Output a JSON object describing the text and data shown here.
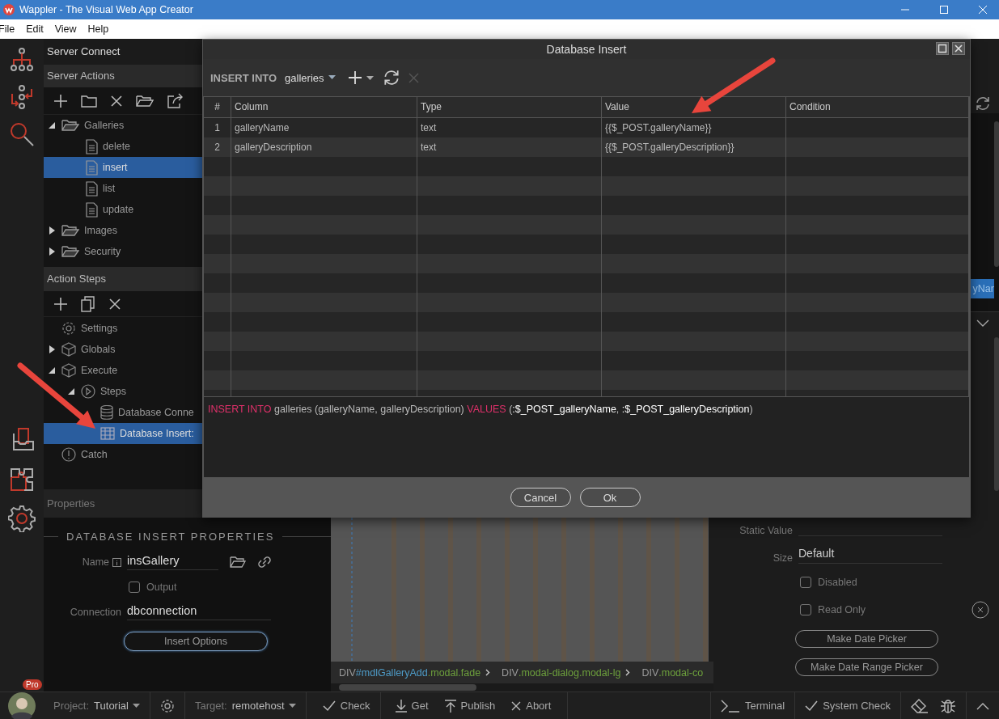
{
  "window": {
    "title": "Wappler - The Visual Web App Creator"
  },
  "menu": [
    "File",
    "Edit",
    "View",
    "Help"
  ],
  "server_connect": {
    "title": "Server Connect",
    "section": "Server Actions",
    "tree": [
      {
        "label": "Galleries",
        "kind": "folder",
        "expanded": true,
        "selected": false,
        "children": [
          {
            "label": "delete",
            "kind": "file",
            "selected": false
          },
          {
            "label": "insert",
            "kind": "file",
            "selected": true
          },
          {
            "label": "list",
            "kind": "file",
            "selected": false
          },
          {
            "label": "update",
            "kind": "file",
            "selected": false
          }
        ]
      },
      {
        "label": "Images",
        "kind": "folder",
        "expanded": false,
        "selected": false
      },
      {
        "label": "Security",
        "kind": "folder",
        "expanded": false,
        "selected": false
      }
    ]
  },
  "action_steps": {
    "title": "Action Steps",
    "tree": [
      {
        "label": "Settings",
        "kind": "settings",
        "selected": false
      },
      {
        "label": "Globals",
        "kind": "cube",
        "expanded": false,
        "selected": false
      },
      {
        "label": "Execute",
        "kind": "cube",
        "expanded": true,
        "selected": false,
        "children": [
          {
            "label": "Steps",
            "kind": "steps",
            "expanded": true,
            "selected": false,
            "children": [
              {
                "label": "Database Conne",
                "kind": "database",
                "selected": false
              },
              {
                "label": "Database Insert:",
                "kind": "table",
                "selected": true
              }
            ]
          }
        ]
      },
      {
        "label": "Catch",
        "kind": "catch",
        "selected": false
      }
    ]
  },
  "properties": {
    "title": "Properties",
    "heading": "DATABASE INSERT PROPERTIES",
    "name_label": "Name",
    "name_value": "insGallery",
    "output": {
      "label": "Output",
      "checked": false
    },
    "connection_label": "Connection",
    "connection_value": "dbconnection",
    "button": "Insert Options"
  },
  "breadcrumb": [
    {
      "tag": "DIV",
      "id": "#mdlGalleryAdd",
      "classes": ".modal.fade"
    },
    {
      "tag": "DIV",
      "classes": ".modal-dialog.modal-lg"
    },
    {
      "tag": "DIV",
      "classes": ".modal-co"
    }
  ],
  "inspector": {
    "partial_field": "yNar",
    "static_value_label": "Static Value",
    "size_label": "Size",
    "size_value": "Default",
    "checkboxes": [
      {
        "label": "Disabled",
        "checked": false
      },
      {
        "label": "Read Only",
        "checked": false
      }
    ],
    "buttons": [
      "Make Date Picker",
      "Make Date Range Picker"
    ]
  },
  "dialog": {
    "title": "Database Insert",
    "insert_into_label": "INSERT INTO",
    "table_name": "galleries",
    "remove_disabled": true,
    "columns": [
      "#",
      "Column",
      "Type",
      "Value",
      "Condition"
    ],
    "rows": [
      {
        "index": "1",
        "column": "galleryName",
        "type": "text",
        "value": "{{$_POST.galleryName}}"
      },
      {
        "index": "2",
        "column": "galleryDescription",
        "type": "text",
        "value": "{{$_POST.galleryDescription}}"
      }
    ],
    "sql": [
      {
        "kind": "keyword",
        "text": "INSERT INTO"
      },
      {
        "kind": "plain",
        "text": " galleries (galleryName, galleryDescription) "
      },
      {
        "kind": "keyword",
        "text": "VALUES"
      },
      {
        "kind": "plain",
        "text": " ("
      },
      {
        "kind": "param",
        "text": ":$_POST_galleryName"
      },
      {
        "kind": "plain",
        "text": ", "
      },
      {
        "kind": "param",
        "text": ":$_POST_galleryDescription"
      },
      {
        "kind": "plain",
        "text": ")"
      }
    ],
    "buttons": [
      "Cancel",
      "Ok"
    ]
  },
  "status_bar": {
    "badge": "Pro",
    "project_label": "Project:",
    "project": "Tutorial",
    "target_label": "Target:",
    "target": "remotehost",
    "actions": [
      {
        "kind": "check",
        "label": "Check"
      },
      {
        "kind": "get",
        "label": "Get"
      },
      {
        "kind": "publish",
        "label": "Publish"
      },
      {
        "kind": "abort",
        "label": "Abort"
      }
    ],
    "tools": [
      {
        "kind": "terminal",
        "label": "Terminal"
      },
      {
        "kind": "check",
        "label": "System Check"
      }
    ]
  }
}
